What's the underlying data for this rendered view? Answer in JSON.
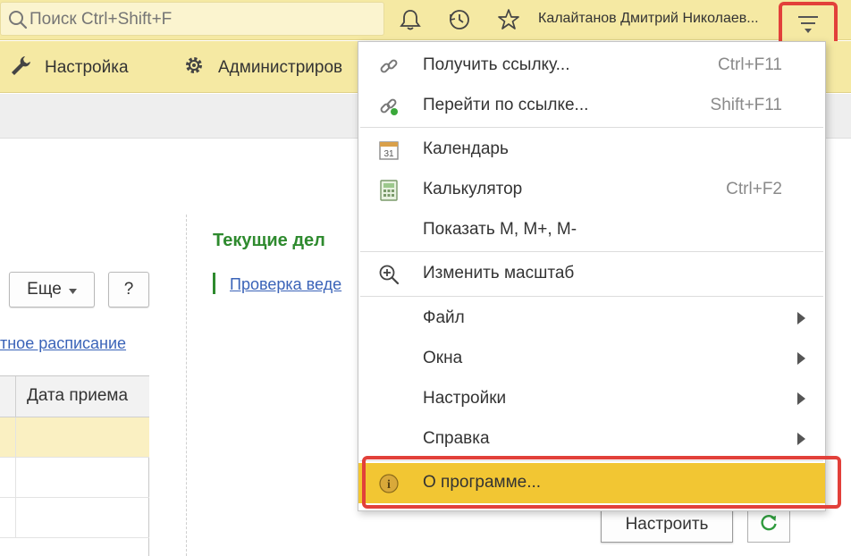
{
  "topbar": {
    "search_placeholder": "Поиск Ctrl+Shift+F",
    "icons": [
      "search-icon",
      "bell-icon",
      "history-icon",
      "star-icon",
      "main-menu-icon"
    ],
    "user_name": "Калайтанов Дмитрий Николаев..."
  },
  "sections": [
    {
      "label": "Настройка",
      "icon": "wrench-icon"
    },
    {
      "label": "Администриров",
      "icon": "gear-icon"
    }
  ],
  "content": {
    "more_button": "Еще",
    "help_button": "?",
    "schedule_link": "тное расписание",
    "current_title": "Текущие дел",
    "check_link": "Проверка веде",
    "grid_header": "Дата приема",
    "setup_button": "Настроить",
    "refresh_icon": "refresh-icon"
  },
  "menu": {
    "items": [
      {
        "label": "Получить ссылку...",
        "shortcut": "Ctrl+F11",
        "icon": "link-icon"
      },
      {
        "label": "Перейти по ссылке...",
        "shortcut": "Shift+F11",
        "icon": "goto-link-icon"
      },
      {
        "label": "Календарь",
        "shortcut": "",
        "icon": "calendar-icon",
        "icon_text": "31"
      },
      {
        "label": "Калькулятор",
        "shortcut": "Ctrl+F2",
        "icon": "calculator-icon"
      },
      {
        "label": "Показать М, М+, М-",
        "shortcut": "",
        "icon": ""
      },
      {
        "label": "Изменить масштаб",
        "shortcut": "",
        "icon": "zoom-icon"
      },
      {
        "label": "Файл",
        "submenu": true
      },
      {
        "label": "Окна",
        "submenu": true
      },
      {
        "label": "Настройки",
        "submenu": true
      },
      {
        "label": "Справка",
        "submenu": true
      },
      {
        "label": "О программе...",
        "icon": "info-icon",
        "icon_text": "i",
        "highlighted": true
      }
    ]
  },
  "colors": {
    "topbar": "#f5e9a3",
    "highlight": "#f2c633",
    "frame": "#e2403a",
    "title_green": "#2e8a2e",
    "link_blue": "#3a63b8"
  }
}
